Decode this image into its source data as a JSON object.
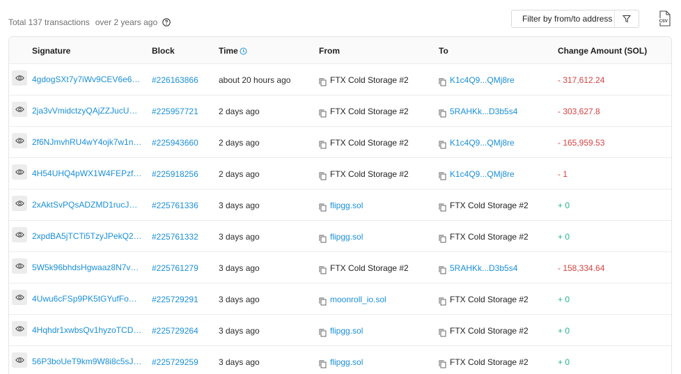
{
  "summary": {
    "total": "Total 137 transactions",
    "ago": "over 2 years ago"
  },
  "filter": {
    "label": "Filter by from/to address"
  },
  "colors": {
    "link": "#1a8fd9",
    "negative": "#d64242",
    "positive": "#1fb58a"
  },
  "icons": [
    "help-icon",
    "filter-icon",
    "csv-icon",
    "eye-icon",
    "copy-icon",
    "clock-icon"
  ],
  "table": {
    "headers": {
      "signature": "Signature",
      "block": "Block",
      "time": "Time",
      "from": "From",
      "to": "To",
      "amount": "Change Amount (SOL)"
    },
    "rows": [
      {
        "signature": "4gdogSXt7y7iWv9CEV6e6eX...",
        "block": "#226163866",
        "time": "about 20 hours ago",
        "from": "FTX Cold Storage #2",
        "from_link": false,
        "to": "K1c4Q9...QMj8re",
        "to_link": true,
        "amount": "- 317,612.24",
        "sign": "neg"
      },
      {
        "signature": "2ja3vVmidctzyQAjZZJucUBZ...",
        "block": "#225957721",
        "time": "2 days ago",
        "from": "FTX Cold Storage #2",
        "from_link": false,
        "to": "5RAHKk...D3b5s4",
        "to_link": true,
        "amount": "- 303,627.8",
        "sign": "neg"
      },
      {
        "signature": "2f6NJmvhRU4wY4ojk7w1nq...",
        "block": "#225943660",
        "time": "2 days ago",
        "from": "FTX Cold Storage #2",
        "from_link": false,
        "to": "K1c4Q9...QMj8re",
        "to_link": true,
        "amount": "- 165,959.53",
        "sign": "neg"
      },
      {
        "signature": "4H54UHQ4pWX1W4FEPzfe5...",
        "block": "#225918256",
        "time": "2 days ago",
        "from": "FTX Cold Storage #2",
        "from_link": false,
        "to": "K1c4Q9...QMj8re",
        "to_link": true,
        "amount": "- 1",
        "sign": "neg"
      },
      {
        "signature": "2xAktSvPQsADZMD1rucJnF...",
        "block": "#225761336",
        "time": "3 days ago",
        "from": "flipgg.sol",
        "from_link": true,
        "to": "FTX Cold Storage #2",
        "to_link": false,
        "amount": "+ 0",
        "sign": "pos"
      },
      {
        "signature": "2xpdBA5jTCTi5TzyJPekQ25i...",
        "block": "#225761332",
        "time": "3 days ago",
        "from": "flipgg.sol",
        "from_link": true,
        "to": "FTX Cold Storage #2",
        "to_link": false,
        "amount": "+ 0",
        "sign": "pos"
      },
      {
        "signature": "5W5k96bhdsHgwaaz8N7vW...",
        "block": "#225761279",
        "time": "3 days ago",
        "from": "FTX Cold Storage #2",
        "from_link": false,
        "to": "5RAHKk...D3b5s4",
        "to_link": true,
        "amount": "- 158,334.64",
        "sign": "neg"
      },
      {
        "signature": "4Uwu6cFSp9PK5tGYufFomz...",
        "block": "#225729291",
        "time": "3 days ago",
        "from": "moonroll_io.sol",
        "from_link": true,
        "to": "FTX Cold Storage #2",
        "to_link": false,
        "amount": "+ 0",
        "sign": "pos"
      },
      {
        "signature": "4Hqhdr1xwbsQv1hyzoTCDu...",
        "block": "#225729264",
        "time": "3 days ago",
        "from": "flipgg.sol",
        "from_link": true,
        "to": "FTX Cold Storage #2",
        "to_link": false,
        "amount": "+ 0",
        "sign": "pos"
      },
      {
        "signature": "56P3boUeT9km9W8i8c5sJg...",
        "block": "#225729259",
        "time": "3 days ago",
        "from": "flipgg.sol",
        "from_link": true,
        "to": "FTX Cold Storage #2",
        "to_link": false,
        "amount": "+ 0",
        "sign": "pos"
      }
    ]
  }
}
